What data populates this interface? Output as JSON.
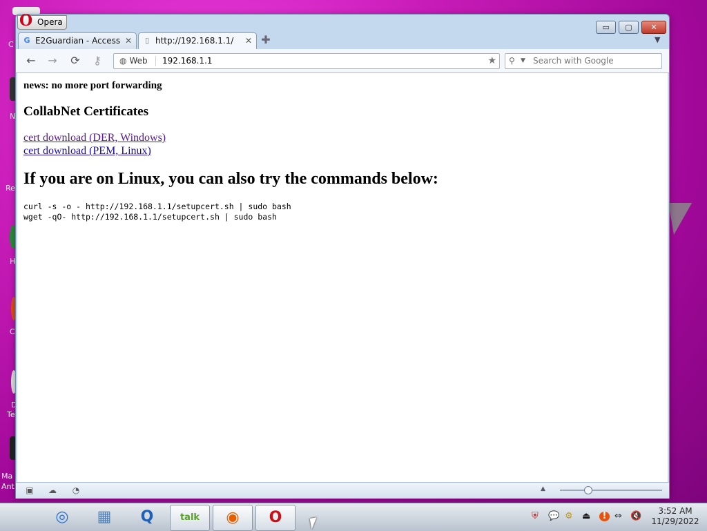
{
  "browser": {
    "menu_label": "Opera",
    "window_controls": {
      "minimize": "▭",
      "maximize": "▢",
      "close": "✕"
    }
  },
  "tabs": [
    {
      "label": "E2Guardian - Access D...",
      "icon": "google-g-icon",
      "glyph": "G",
      "close": "✕"
    },
    {
      "label": "http://192.168.1.1/",
      "icon": "page-icon",
      "glyph": "▯",
      "close": "✕"
    }
  ],
  "new_tab": "✚",
  "tab_menu": "▼",
  "toolbar": {
    "back": "←",
    "forward": "→",
    "reload": "⟳",
    "key": "⚷",
    "addr_scope": "Web",
    "addr_globe": "◍",
    "url": "192.168.1.1",
    "star": "★",
    "search_placeholder": "Search with Google",
    "search_icon": "⚲",
    "search_arrow": "▼"
  },
  "content": {
    "news": "news: no more port forwarding",
    "cert_heading": "CollabNet Certificates",
    "link_der": "cert download (DER, Windows)",
    "link_pem": "cert download (PEM, Linux)",
    "linux_heading": "If you are on Linux, you can also try the commands below:",
    "cmd_curl": "curl -s -o - http://192.168.1.1/setupcert.sh | sudo bash",
    "cmd_wget": "wget -qO- http://192.168.1.1/setupcert.sh | sudo bash"
  },
  "statusbar": {
    "panel_icon": "▣",
    "cloud_icon": "☁",
    "speed_icon": "◔",
    "zoom_up": "▲",
    "zoom_level_fraction": 0.28
  },
  "taskbar": {
    "start_glyph": "",
    "items": [
      {
        "name": "safari",
        "glyph": "◎",
        "color": "#2a6fcf"
      },
      {
        "name": "folder",
        "glyph": "▦",
        "color": "#4d7fb8"
      },
      {
        "name": "quicktime",
        "glyph": "Q",
        "color": "#1d5fb9"
      },
      {
        "name": "google-talk",
        "glyph": "talk",
        "color": "#5aa02c"
      },
      {
        "name": "firefox",
        "glyph": "◉",
        "color": "#e66000"
      },
      {
        "name": "opera",
        "glyph": "O",
        "color": "#cc0f16"
      }
    ],
    "tray": [
      "⛨",
      "💬",
      "⚙",
      "⏏",
      "!",
      "⇔",
      "🔇"
    ],
    "clock_time": "3:52 AM",
    "clock_date": "11/29/2022"
  },
  "desktop": {
    "labels": [
      "C",
      "N",
      "Re",
      "H",
      "C",
      "D",
      "Te",
      "Ma",
      "Ant"
    ]
  }
}
